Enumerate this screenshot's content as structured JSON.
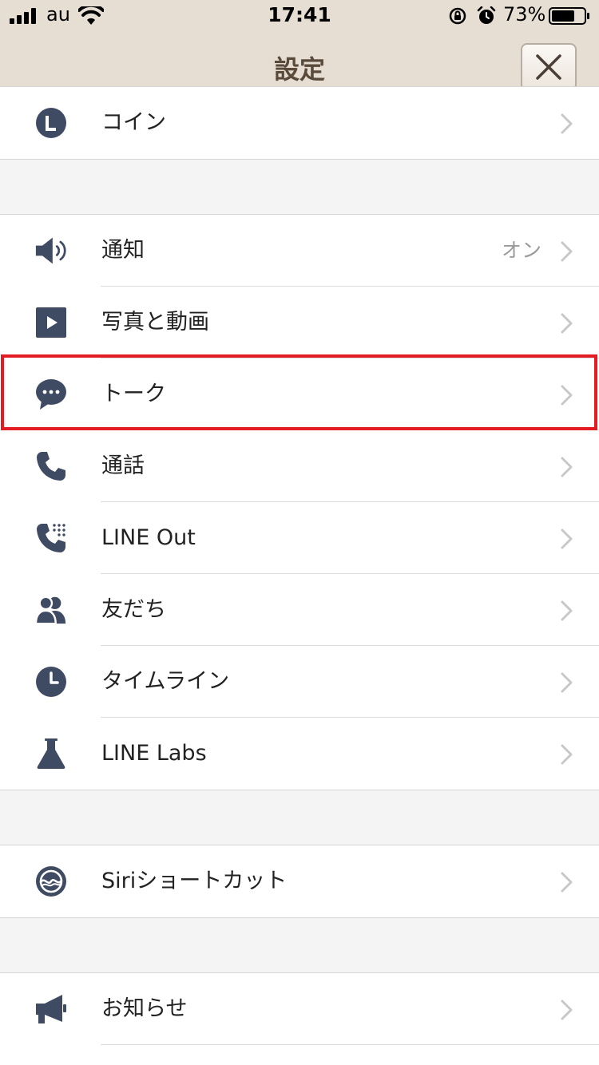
{
  "status_bar": {
    "carrier": "au",
    "time": "17:41",
    "battery_percent": "73%",
    "battery_level": 0.73
  },
  "nav": {
    "title": "設定",
    "close_icon": "close-icon"
  },
  "groups": [
    {
      "items": [
        {
          "label": "コイン",
          "icon": "line-coin-icon",
          "value": ""
        }
      ]
    },
    {
      "items": [
        {
          "label": "通知",
          "icon": "speaker-icon",
          "value": "オン"
        },
        {
          "label": "写真と動画",
          "icon": "play-icon",
          "value": ""
        },
        {
          "label": "トーク",
          "icon": "chat-bubble-icon",
          "value": ""
        },
        {
          "label": "通話",
          "icon": "phone-icon",
          "value": ""
        },
        {
          "label": "LINE Out",
          "icon": "phone-keypad-icon",
          "value": ""
        },
        {
          "label": "友だち",
          "icon": "friends-icon",
          "value": ""
        },
        {
          "label": "タイムライン",
          "icon": "clock-icon",
          "value": ""
        },
        {
          "label": "LINE Labs",
          "icon": "flask-icon",
          "value": ""
        }
      ]
    },
    {
      "items": [
        {
          "label": "Siriショートカット",
          "icon": "siri-icon",
          "value": ""
        }
      ]
    },
    {
      "items": [
        {
          "label": "お知らせ",
          "icon": "megaphone-icon",
          "value": ""
        }
      ]
    }
  ],
  "colors": {
    "header_bg": "#e6ddd3",
    "title_color": "#5a4a3c",
    "icon_color": "#3f4a63",
    "highlight_border": "#e31b23"
  }
}
